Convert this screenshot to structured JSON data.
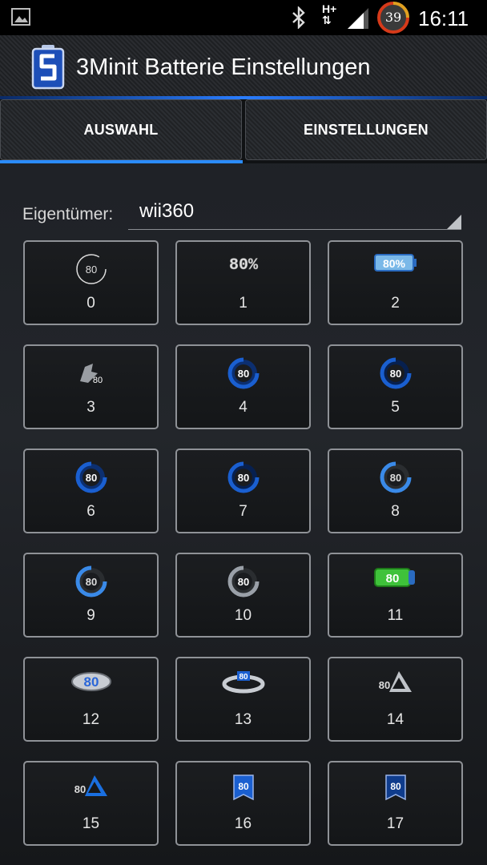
{
  "status_bar": {
    "network": "H+",
    "battery_level": "39",
    "clock": "16:11",
    "icons": [
      "picture-icon",
      "bluetooth-icon",
      "network-hplus-icon",
      "signal-icon",
      "battery-circle-icon"
    ]
  },
  "app": {
    "title": "3Minit Batterie Einstellungen",
    "icon": "battery-s-logo-icon"
  },
  "tabs": [
    {
      "label": "AUSWAHL",
      "selected": true
    },
    {
      "label": "EINSTELLUNGEN",
      "selected": false
    }
  ],
  "owner": {
    "label": "Eigentümer:",
    "value": "wii360"
  },
  "styles": [
    {
      "number": "0",
      "preview_text": "80"
    },
    {
      "number": "1",
      "preview_text": "80%"
    },
    {
      "number": "2",
      "preview_text": "80%"
    },
    {
      "number": "3",
      "preview_text": "80"
    },
    {
      "number": "4",
      "preview_text": "80"
    },
    {
      "number": "5",
      "preview_text": "80"
    },
    {
      "number": "6",
      "preview_text": "80"
    },
    {
      "number": "7",
      "preview_text": "80"
    },
    {
      "number": "8",
      "preview_text": "80"
    },
    {
      "number": "9",
      "preview_text": "80"
    },
    {
      "number": "10",
      "preview_text": "80"
    },
    {
      "number": "11",
      "preview_text": "80"
    },
    {
      "number": "12",
      "preview_text": "80"
    },
    {
      "number": "13",
      "preview_text": "80"
    },
    {
      "number": "14",
      "preview_text": "80"
    },
    {
      "number": "15",
      "preview_text": "80"
    },
    {
      "number": "16",
      "preview_text": "80"
    },
    {
      "number": "17",
      "preview_text": "80"
    }
  ],
  "colors": {
    "accent": "#2a8cff",
    "background": "#1e2125",
    "cell_border": "#8f9297"
  }
}
